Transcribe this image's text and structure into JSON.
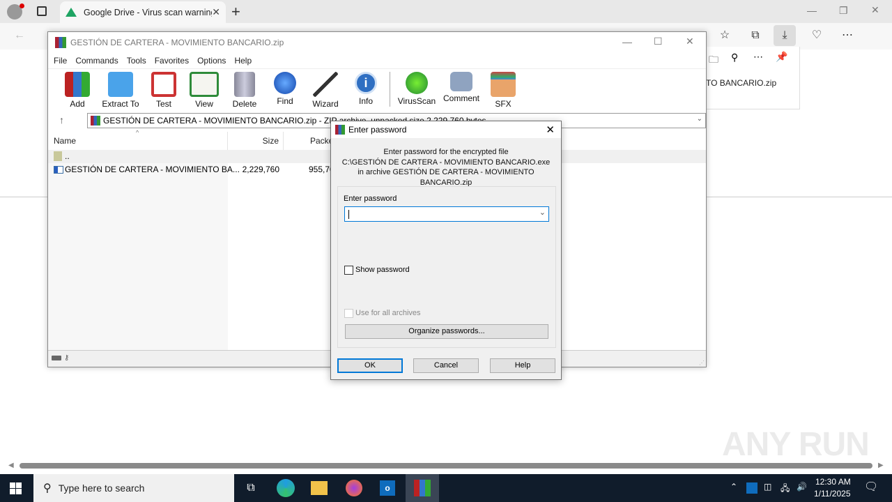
{
  "browser": {
    "tab_title": "Google Drive - Virus scan warning",
    "download_panel_filename": "TO BANCARIO.zip",
    "window_controls": [
      "minimize",
      "restore",
      "close"
    ],
    "toolbar_icons": [
      "back-icon",
      "refresh-icon",
      "favorites-icon",
      "collections-icon",
      "downloads-icon",
      "browser-essentials-icon",
      "more-icon",
      "copilot-icon"
    ]
  },
  "winrar": {
    "title": "GESTIÓN DE CARTERA - MOVIMIENTO BANCARIO.zip",
    "menu": [
      "File",
      "Commands",
      "Tools",
      "Favorites",
      "Options",
      "Help"
    ],
    "toolbar": [
      "Add",
      "Extract To",
      "Test",
      "View",
      "Delete",
      "Find",
      "Wizard",
      "Info",
      "VirusScan",
      "Comment",
      "SFX"
    ],
    "address": "GESTIÓN DE CARTERA - MOVIMIENTO BANCARIO.zip - ZIP archive, unpacked size 2,229,760 bytes",
    "columns": [
      "Name",
      "Size",
      "Packed"
    ],
    "rows": [
      {
        "name": "..",
        "size": "",
        "packed": ""
      },
      {
        "name": "GESTIÓN DE CARTERA - MOVIMIENTO BA...",
        "size": "2,229,760",
        "packed": "955,70"
      }
    ]
  },
  "dialog": {
    "title": "Enter password",
    "msg_line1": "Enter password for the encrypted file",
    "msg_line2": "C:\\GESTIÓN DE CARTERA - MOVIMIENTO BANCARIO.exe",
    "msg_line3": "in archive GESTIÓN DE CARTERA - MOVIMIENTO BANCARIO.zip",
    "password_label": "Enter password",
    "password_value": "",
    "show_password": "Show password",
    "use_for_all": "Use for all archives",
    "organize": "Organize passwords...",
    "ok": "OK",
    "cancel": "Cancel",
    "help": "Help"
  },
  "taskbar": {
    "search_placeholder": "Type here to search",
    "time": "12:30 AM",
    "date": "1/11/2025"
  },
  "watermark": "ANY RUN"
}
